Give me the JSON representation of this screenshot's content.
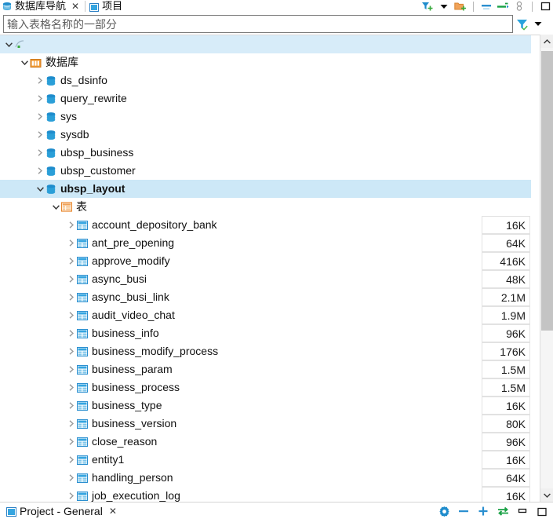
{
  "window": {
    "tabs": [
      {
        "label": "数据库导航",
        "icon": "database-icon",
        "closable": true,
        "active": true
      },
      {
        "label": "项目",
        "icon": "project-icon",
        "closable": false,
        "active": false
      }
    ],
    "top_toolbar": [
      {
        "name": "filter-add-icon",
        "title": ""
      },
      {
        "name": "chevron-down-icon",
        "title": ""
      },
      {
        "name": "folder-add-icon",
        "title": ""
      },
      {
        "name": "collapse-all-icon",
        "title": ""
      },
      {
        "name": "link-editor-icon",
        "title": ""
      },
      {
        "name": "pin-view-icon",
        "title": ""
      },
      {
        "name": "maximize-view-icon",
        "title": ""
      }
    ]
  },
  "search": {
    "placeholder": "输入表格名称的一部分",
    "value": "",
    "filter_button": "filter-icon",
    "filter_caret": "chevron-down-icon"
  },
  "tree": {
    "connection_row": {
      "label": "",
      "icon": "connection-icon",
      "expanded": true,
      "redacted": true
    },
    "database_row": {
      "label": "数据库",
      "icon": "database-folder-icon",
      "expanded": true,
      "redacted": true
    },
    "schemas": [
      {
        "label": "ds_dsinfo",
        "icon": "schema-icon",
        "expanded": false,
        "selected": false
      },
      {
        "label": "query_rewrite",
        "icon": "schema-icon",
        "expanded": false,
        "selected": false
      },
      {
        "label": "sys",
        "icon": "schema-icon",
        "expanded": false,
        "selected": false
      },
      {
        "label": "sysdb",
        "icon": "schema-icon",
        "expanded": false,
        "selected": false
      },
      {
        "label": "ubsp_business",
        "icon": "schema-icon",
        "expanded": false,
        "selected": false
      },
      {
        "label": "ubsp_customer",
        "icon": "schema-icon",
        "expanded": false,
        "selected": false
      },
      {
        "label": "ubsp_layout",
        "icon": "schema-icon",
        "expanded": true,
        "selected": true
      }
    ],
    "tables_folder": {
      "label": "表",
      "icon": "tables-folder-icon",
      "expanded": true
    },
    "tables": [
      {
        "label": "account_depository_bank",
        "icon": "table-icon",
        "size": "16K"
      },
      {
        "label": "ant_pre_opening",
        "icon": "table-icon",
        "size": "64K"
      },
      {
        "label": "approve_modify",
        "icon": "table-icon",
        "size": "416K"
      },
      {
        "label": "async_busi",
        "icon": "table-icon",
        "size": "48K"
      },
      {
        "label": "async_busi_link",
        "icon": "table-icon",
        "size": "2.1M"
      },
      {
        "label": "audit_video_chat",
        "icon": "table-icon",
        "size": "1.9M"
      },
      {
        "label": "business_info",
        "icon": "table-icon",
        "size": "96K"
      },
      {
        "label": "business_modify_process",
        "icon": "table-icon",
        "size": "176K"
      },
      {
        "label": "business_param",
        "icon": "table-icon",
        "size": "1.5M"
      },
      {
        "label": "business_process",
        "icon": "table-icon",
        "size": "1.5M"
      },
      {
        "label": "business_type",
        "icon": "table-icon",
        "size": "16K"
      },
      {
        "label": "business_version",
        "icon": "table-icon",
        "size": "80K"
      },
      {
        "label": "close_reason",
        "icon": "table-icon",
        "size": "96K"
      },
      {
        "label": "entity1",
        "icon": "table-icon",
        "size": "16K"
      },
      {
        "label": "handling_person",
        "icon": "table-icon",
        "size": "64K"
      },
      {
        "label": "job_execution_log",
        "icon": "table-icon",
        "size": "16K"
      }
    ]
  },
  "scrollbar": {
    "up_arrow": "chevron-up-icon",
    "down_arrow": "chevron-down-icon"
  },
  "bottom": {
    "tab": {
      "label": "Project - General",
      "icon": "project-icon",
      "closable": true
    },
    "toolbar": [
      {
        "name": "settings-gear-icon"
      },
      {
        "name": "minimize-icon"
      },
      {
        "name": "add-icon"
      },
      {
        "name": "switch-icon"
      },
      {
        "name": "restore-icon"
      },
      {
        "name": "maximize-icon"
      }
    ]
  },
  "colors": {
    "accent_blue": "#1f8ccc",
    "selection_blue": "#cde8f7",
    "icon_orange": "#e8862a",
    "icon_green": "#37a93c",
    "text": "#101010"
  }
}
